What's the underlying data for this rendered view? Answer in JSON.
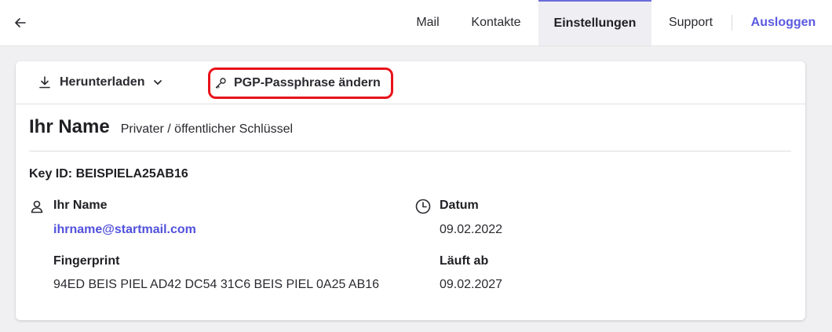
{
  "nav": {
    "back_icon": "arrow-left-icon",
    "items": [
      {
        "label": "Mail"
      },
      {
        "label": "Kontakte"
      },
      {
        "label": "Einstellungen",
        "active": true
      },
      {
        "label": "Support"
      }
    ],
    "logout": "Ausloggen",
    "accent_color": "#5a5ae0"
  },
  "toolbar": {
    "download_label": "Herunterladen",
    "download_icon": "download-icon",
    "download_dropdown_icon": "chevron-down-icon",
    "passphrase_label": "PGP-Passphrase ändern",
    "passphrase_icon": "key-icon",
    "highlight_color": "#e8121b"
  },
  "key": {
    "name": "Ihr Name",
    "type": "Privater / öffentlicher Schlüssel",
    "id_label": "Key ID: BEISPIELA25AB16",
    "owner_icon": "user-icon",
    "owner_label": "Ihr Name",
    "email": "ihrname@startmail.com",
    "fingerprint_label": "Fingerprint",
    "fingerprint": "94ED BEIS PIEL AD42 DC54 31C6 BEIS PIEL 0A25 AB16",
    "date_icon": "clock-icon",
    "date_label": "Datum",
    "date": "09.02.2022",
    "expires_label": "Läuft ab",
    "expires": "09.02.2027"
  }
}
